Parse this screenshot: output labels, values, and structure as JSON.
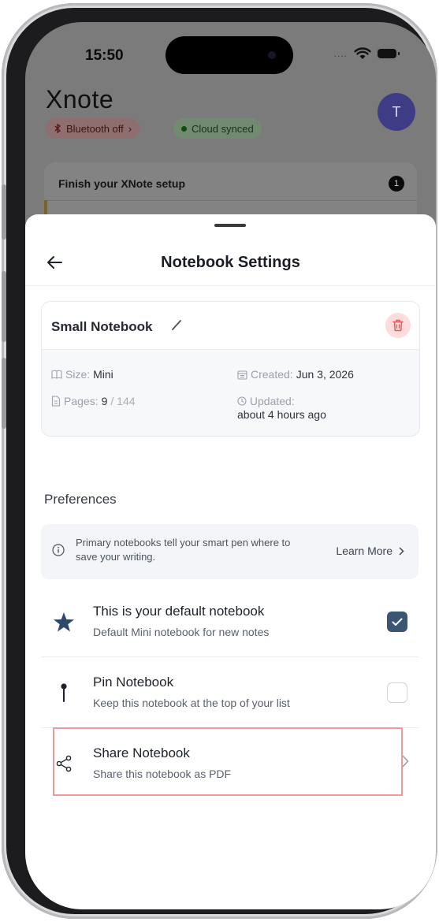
{
  "status_bar": {
    "time": "15:50",
    "dots": "...."
  },
  "app": {
    "logo": "Xnote",
    "avatar_initial": "T",
    "chips": {
      "bluetooth": "Bluetooth off",
      "bluetooth_chevron": "›",
      "cloud": "Cloud synced"
    },
    "setup_card": {
      "title": "Finish your XNote setup",
      "badge": "1"
    }
  },
  "sheet": {
    "title": "Notebook Settings",
    "notebook": {
      "name": "Small Notebook",
      "size_label": "Size:",
      "size_value": "Mini",
      "pages_label": "Pages:",
      "pages_value": "9",
      "pages_total": "/ 144",
      "created_label": "Created:",
      "created_value": "Jun 3, 2026",
      "updated_label": "Updated:",
      "updated_value": "about 4 hours ago"
    },
    "preferences": {
      "title": "Preferences",
      "info_text": "Primary notebooks tell your smart pen where to save your writing.",
      "learn_more": "Learn More",
      "items": [
        {
          "title": "This is your default notebook",
          "subtitle": "Default Mini notebook for new notes",
          "icon": "star-icon",
          "checked": true
        },
        {
          "title": "Pin Notebook",
          "subtitle": "Keep this notebook at the top of your list",
          "icon": "pin-icon",
          "checked": false
        },
        {
          "title": "Share Notebook",
          "subtitle": "Share this notebook as PDF",
          "icon": "share-icon"
        }
      ]
    }
  },
  "colors": {
    "accent": "#3c5573",
    "avatar": "#3f3c86",
    "delete_bg": "#fcdcdc",
    "delete_icon": "#e25b5b",
    "highlight_border": "#ef9a9a"
  }
}
